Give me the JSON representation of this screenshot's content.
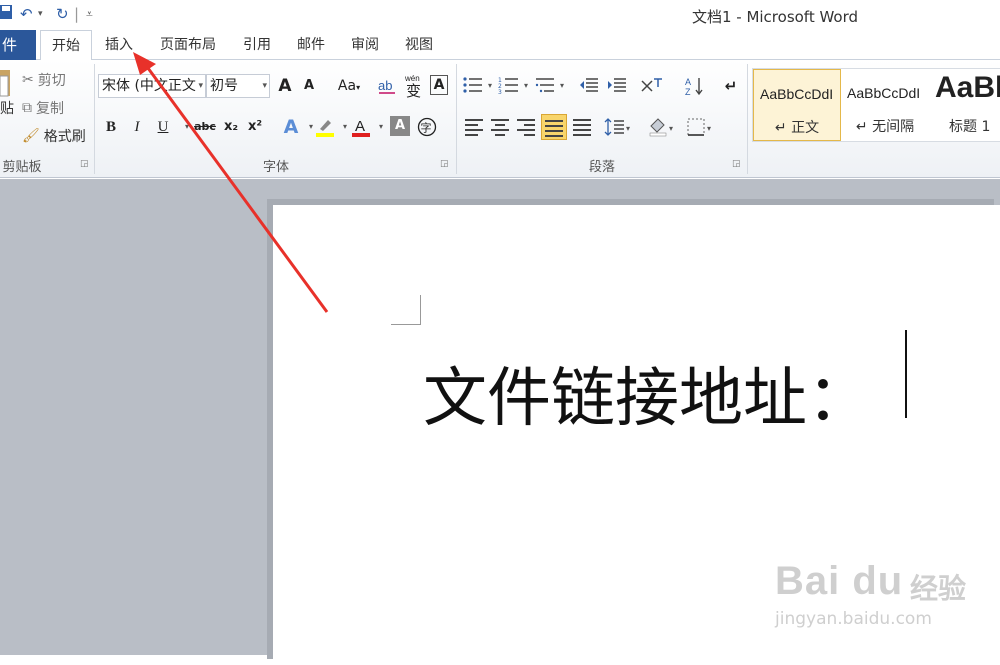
{
  "titlebar": {
    "title": "文档1 - Microsoft Word"
  },
  "qat": {
    "save_icon": "save-icon",
    "undo_icon": "undo-icon",
    "redo_icon": "redo-icon",
    "customize_icon": "customize-icon"
  },
  "tabs": {
    "file": "件",
    "items": [
      "开始",
      "插入",
      "页面布局",
      "引用",
      "邮件",
      "审阅",
      "视图"
    ],
    "active": "开始"
  },
  "clipboard": {
    "paste": "贴",
    "cut": "剪切",
    "copy": "复制",
    "format_painter": "格式刷",
    "label": "剪贴板"
  },
  "font": {
    "font_name": "宋体 (中文正文",
    "font_size": "初号",
    "label": "字体",
    "buttons": {
      "bold": "B",
      "italic": "I",
      "underline": "U",
      "strike": "abc",
      "subscript": "x₂",
      "superscript": "x²",
      "change_case": "Aa",
      "clear": "A",
      "grow": "A",
      "shrink": "A",
      "text_effect": "A",
      "font_color": "A",
      "shade": "A",
      "phonetic": "wén",
      "phonetic_char": "变",
      "enclose": "字"
    },
    "colors": {
      "highlight": "#ffff00",
      "font_color": "#e02020"
    }
  },
  "paragraph": {
    "label": "段落"
  },
  "styles": {
    "items": [
      {
        "sample": "AaBbCcDdI",
        "name": "↵ 正文"
      },
      {
        "sample": "AaBbCcDdI",
        "name": "↵ 无间隔"
      },
      {
        "sample": "AaBl",
        "name": "标题 1"
      }
    ],
    "selected": "正文"
  },
  "document": {
    "text": "文件链接地址："
  },
  "watermark": {
    "logo": "Bai du",
    "cn": "经验",
    "url": "jingyan.baidu.com"
  },
  "annotation": {
    "arrow_color": "#e8312a"
  }
}
